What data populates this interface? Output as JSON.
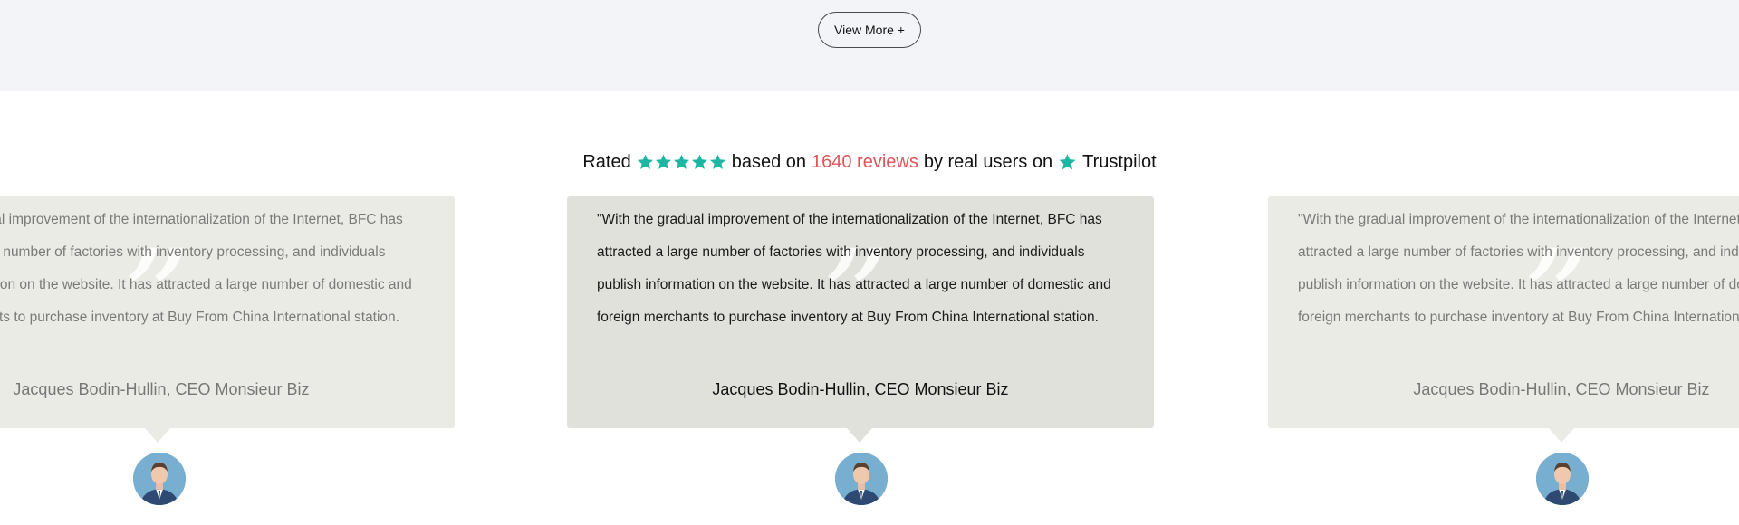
{
  "view_more_label": "View More +",
  "rating": {
    "rated_label": "Rated",
    "based_on_label": "based on",
    "reviews_link": "1640 reviews",
    "by_users_label": "by real users on",
    "platform_name": "Trustpilot",
    "stars": 5,
    "star_color": "#00b67a",
    "link_color": "#e05557"
  },
  "testimonials": [
    {
      "quote": "\"With the gradual improvement of the internationalization of the Internet, BFC has attracted a large number of factories with inventory processing, and individuals publish information on the website. It has attracted a large number of domestic and foreign merchants to purchase inventory at Buy From China International station.",
      "author": "Jacques Bodin-Hullin, CEO Monsieur Biz",
      "avatar_icon": "businessman-avatar-icon"
    },
    {
      "quote": "\"With the gradual improvement of the internationalization of the Internet, BFC has attracted a large number of factories with inventory processing, and individuals publish information on the website. It has attracted a large number of domestic and foreign merchants to purchase inventory at Buy From China International station.",
      "author": "Jacques Bodin-Hullin, CEO Monsieur Biz",
      "avatar_icon": "businessman-avatar-icon"
    },
    {
      "quote": "\"With the gradual improvement of the internationalization of the Internet, BFC has attracted a large number of factories with inventory processing, and individuals publish information on the website. It has attracted a large number of domestic and foreign merchants to purchase inventory at Buy From China International station.",
      "author": "Jacques Bodin-Hullin, CEO Monsieur Biz",
      "avatar_icon": "businessman-avatar-icon"
    }
  ],
  "quote_mark_glyph": "”"
}
